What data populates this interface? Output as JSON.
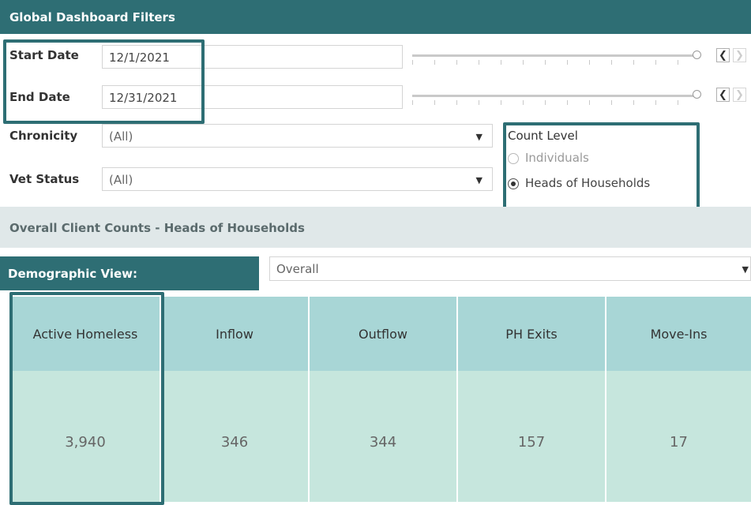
{
  "header": {
    "title": "Global Dashboard Filters"
  },
  "filters": {
    "start_date": {
      "label": "Start Date",
      "value": "12/1/2021"
    },
    "end_date": {
      "label": "End Date",
      "value": "12/31/2021"
    },
    "chronicity": {
      "label": "Chronicity",
      "value": "(All)"
    },
    "vet_status": {
      "label": "Vet Status",
      "value": "(All)"
    }
  },
  "slider_nav": {
    "prev": "❮",
    "next": "❯"
  },
  "count_level": {
    "title": "Count Level",
    "options": [
      {
        "label": "Individuals",
        "selected": false
      },
      {
        "label": "Heads of Households",
        "selected": true
      }
    ]
  },
  "section": {
    "title": "Overall Client Counts - Heads of Households"
  },
  "demographic": {
    "label": "Demographic View:",
    "value": "Overall"
  },
  "table": {
    "columns": [
      {
        "header": "Active Homeless",
        "value": "3,940"
      },
      {
        "header": "Inflow",
        "value": "346"
      },
      {
        "header": "Outflow",
        "value": "344"
      },
      {
        "header": "PH Exits",
        "value": "157"
      },
      {
        "header": "Move-Ins",
        "value": "17"
      }
    ]
  },
  "colors": {
    "brand": "#2e6e74",
    "header_cell": "#a8d6d6",
    "body_cell": "#c6e6dd"
  }
}
